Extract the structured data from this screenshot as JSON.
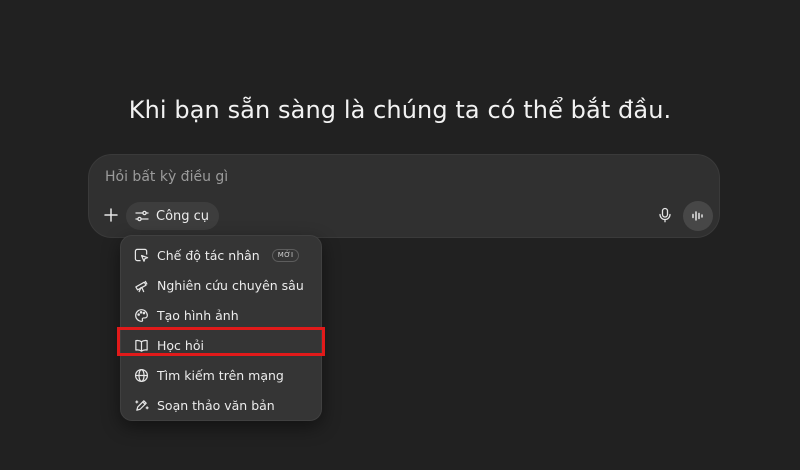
{
  "headline": "Khi bạn sẵn sàng là chúng ta có thể bắt đầu.",
  "composer": {
    "placeholder": "Hỏi bất kỳ điều gì",
    "tools_label": "Công cụ"
  },
  "menu": {
    "items": [
      {
        "label": "Chế độ tác nhân",
        "badge": "MỚI",
        "icon": "agent-cursor-icon"
      },
      {
        "label": "Nghiên cứu chuyên sâu",
        "icon": "telescope-icon"
      },
      {
        "label": "Tạo hình ảnh",
        "icon": "palette-icon"
      },
      {
        "label": "Học hỏi",
        "icon": "book-open-icon"
      },
      {
        "label": "Tìm kiếm trên mạng",
        "icon": "globe-icon"
      },
      {
        "label": "Soạn thảo văn bản",
        "icon": "pen-icon"
      }
    ],
    "highlighted_item": "Học hỏi"
  },
  "colors": {
    "background": "#212121",
    "composer": "#303030",
    "menu": "#353535",
    "highlight": "#e11a1a",
    "text": "#ececec"
  }
}
